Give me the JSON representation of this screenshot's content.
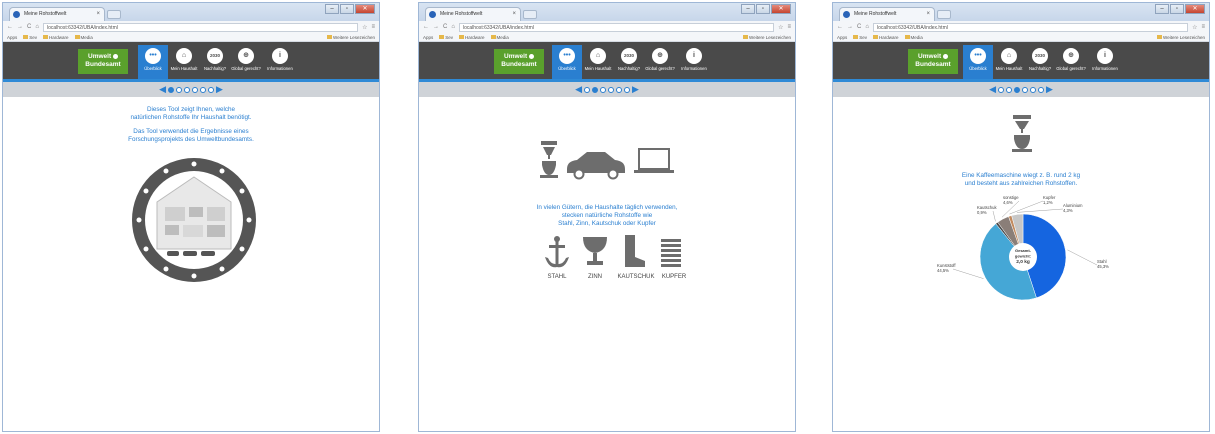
{
  "browser": {
    "tab_title": "Meine Rohstoffwelt",
    "tab_close": "×",
    "address": "localhost:63342/UBA/index.html",
    "bookmarks": [
      "Apps",
      "Sev",
      "Hardware",
      "Media"
    ],
    "bookmarks_right": "Weitere Lesezeichen"
  },
  "app": {
    "logo_line1": "Umwelt",
    "logo_line2": "Bundesamt",
    "nav": [
      {
        "label": "Überblick",
        "icon": "ellipsis-icon",
        "glyph": "•••"
      },
      {
        "label": "Mein Haushalt",
        "icon": "house-icon",
        "glyph": "⌂"
      },
      {
        "label": "Nachhaltig?",
        "icon": "year-2030-icon",
        "glyph": "2030"
      },
      {
        "label": "Global gerecht?",
        "icon": "globe-icon",
        "glyph": "⊕"
      },
      {
        "label": "Informationen",
        "icon": "info-icon",
        "glyph": "i"
      }
    ],
    "accent": "#2a7fd0",
    "logo_green": "#5aa02c"
  },
  "screen1": {
    "text1_l1": "Dieses Tool zeigt Ihnen, welche",
    "text1_l2": "natürlichen Rohstoffe Ihr Haushalt benötigt.",
    "text2_l1": "Das Tool verwendet die Ergebnisse eines",
    "text2_l2": "Forschungsprojekts des Umweltbundesamts."
  },
  "screen2": {
    "text_l1": "In vielen Gütern, die Haushalte täglich verwenden,",
    "text_l2": "stecken natürliche Rohstoffe wie",
    "text_l3": "Stahl, Zinn, Kautschuk oder Kupfer",
    "materials": [
      "STAHL",
      "ZINN",
      "KAUTSCHUK",
      "KUPFER"
    ]
  },
  "screen3": {
    "text_l1": "Eine Kaffeemaschine wiegt z. B. rund 2 kg",
    "text_l2": "und besteht aus zahlreichen Rohstoffen.",
    "center_l1": "Gesamt-",
    "center_l2": "gewicht:",
    "center_l3": "2,0 kg"
  },
  "chart_data": {
    "type": "pie",
    "series": [
      {
        "name": "Stahl",
        "label": "45,3%",
        "value": 45.3,
        "color": "#1565e0"
      },
      {
        "name": "Kunststoff",
        "label": "44,5%",
        "value": 44.5,
        "color": "#45a7d6"
      },
      {
        "name": "Kautschuk",
        "label": "0,9%",
        "value": 0.9,
        "color": "#4a4a4a"
      },
      {
        "name": "sonstige",
        "label": "4,6%",
        "value": 4.6,
        "color": "#8a7e78"
      },
      {
        "name": "Kupfer",
        "label": "1,2%",
        "value": 1.2,
        "color": "#c28a5e"
      },
      {
        "name": "Aluminium",
        "label": "4,3%",
        "value": 4.3,
        "color": "#c7c7c7"
      }
    ]
  }
}
